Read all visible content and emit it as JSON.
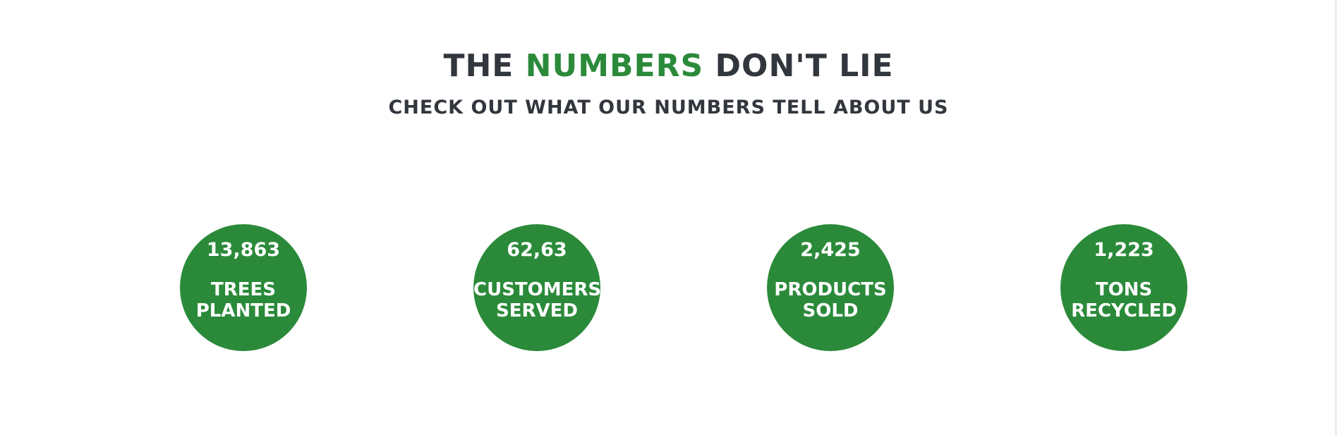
{
  "section": {
    "title_prefix": "THE",
    "title_accent": "NUMBERS",
    "title_suffix": "DON'T LIE",
    "subtitle": "CHECK OUT WHAT OUR NUMBERS TELL ABOUT US"
  },
  "colors": {
    "accent": "#2b8a3a",
    "text_dark": "#32363d",
    "background": "#ffffff"
  },
  "stats": [
    {
      "value": "13,863",
      "label_line1": "TREES",
      "label_line2": "PLANTED"
    },
    {
      "value": "62,63",
      "label_line1": "CUSTOMERS",
      "label_line2": "SERVED"
    },
    {
      "value": "2,425",
      "label_line1": "PRODUCTS",
      "label_line2": "SOLD"
    },
    {
      "value": "1,223",
      "label_line1": "TONS",
      "label_line2": "RECYCLED"
    }
  ]
}
